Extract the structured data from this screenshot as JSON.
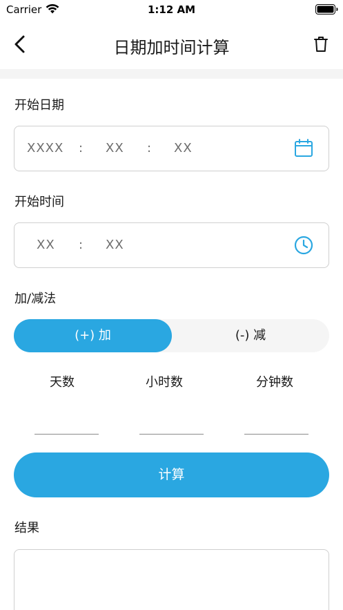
{
  "status_bar": {
    "carrier": "Carrier",
    "time": "1:12 AM"
  },
  "nav": {
    "title": "日期加时间计算"
  },
  "start_date": {
    "label": "开始日期",
    "year_placeholder": "XXXX",
    "month_placeholder": "XX",
    "day_placeholder": "XX",
    "separator": ":"
  },
  "start_time": {
    "label": "开始时间",
    "hour_placeholder": "XX",
    "minute_placeholder": "XX",
    "separator": ":"
  },
  "operation": {
    "label": "加/减法",
    "add_label": "(+) 加",
    "subtract_label": "(-) 减",
    "selected": "add"
  },
  "fields": {
    "days_label": "天数",
    "hours_label": "小时数",
    "minutes_label": "分钟数"
  },
  "calc_button_label": "计算",
  "result": {
    "label": "结果",
    "value": ""
  },
  "colors": {
    "accent": "#2aa7e1",
    "toggle_bg": "#f5f5f5",
    "border": "#cfcfcf"
  },
  "icons": {
    "wifi": "wifi-icon",
    "battery": "battery-icon",
    "back": "chevron-left-icon",
    "trash": "trash-icon",
    "calendar": "calendar-icon",
    "clock": "clock-icon"
  }
}
